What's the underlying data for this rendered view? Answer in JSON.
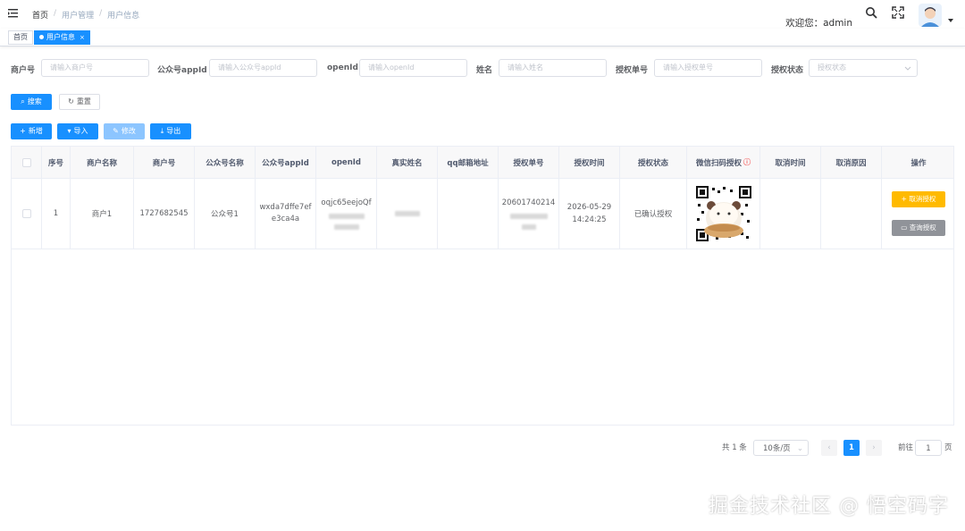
{
  "header": {
    "breadcrumb": [
      "首页",
      "用户管理",
      "用户信息"
    ],
    "breadcrumb_sep": "/",
    "welcome": "欢迎您：admin"
  },
  "tags": [
    {
      "label": "首页",
      "active": false
    },
    {
      "label": "用户信息",
      "active": true,
      "close": "×"
    }
  ],
  "search_form": {
    "fields": [
      {
        "label": "商户号",
        "placeholder": "请输入商户号"
      },
      {
        "label": "公众号appId",
        "placeholder": "请输入公众号appId"
      },
      {
        "label": "openId",
        "placeholder": "请输入openId"
      },
      {
        "label": "姓名",
        "placeholder": "请输入姓名"
      },
      {
        "label": "授权单号",
        "placeholder": "请输入授权单号"
      },
      {
        "label": "授权状态",
        "placeholder": "授权状态"
      }
    ],
    "search_label": "搜索",
    "reset_label": "重置"
  },
  "toolbar": {
    "add_label": "新增",
    "import_label": "导入",
    "edit_label": "修改",
    "export_label": "导出"
  },
  "table": {
    "columns": [
      "序号",
      "商户名称",
      "商户号",
      "公众号名称",
      "公众号appId",
      "openId",
      "真实姓名",
      "qq邮箱地址",
      "授权单号",
      "授权时间",
      "授权状态",
      "微信扫码授权",
      "取消时间",
      "取消原因",
      "操作"
    ],
    "rows": [
      {
        "index": "1",
        "merchant_name": "商户1",
        "merchant_no": "1727682545",
        "account_name": "公众号1",
        "appid": "wxda7dffe7efe3ca4a",
        "openid": "oqjc65eejoQf",
        "auth_no": "20601740214",
        "auth_time": "2026-05-29 14:24:25",
        "auth_status": "已确认授权",
        "cancel_label": "取消授权",
        "query_label": "查询授权"
      }
    ]
  },
  "pagination": {
    "total": "共 1 条",
    "page_size": "10条/页",
    "current_page": "1",
    "goto_label": "前往",
    "goto_value": "1",
    "page_unit": "页"
  },
  "watermark": "掘金技术社区 @ 悟空码字",
  "colors": {
    "primary": "#1890ff",
    "warning": "#ffba00",
    "info": "#909399"
  }
}
